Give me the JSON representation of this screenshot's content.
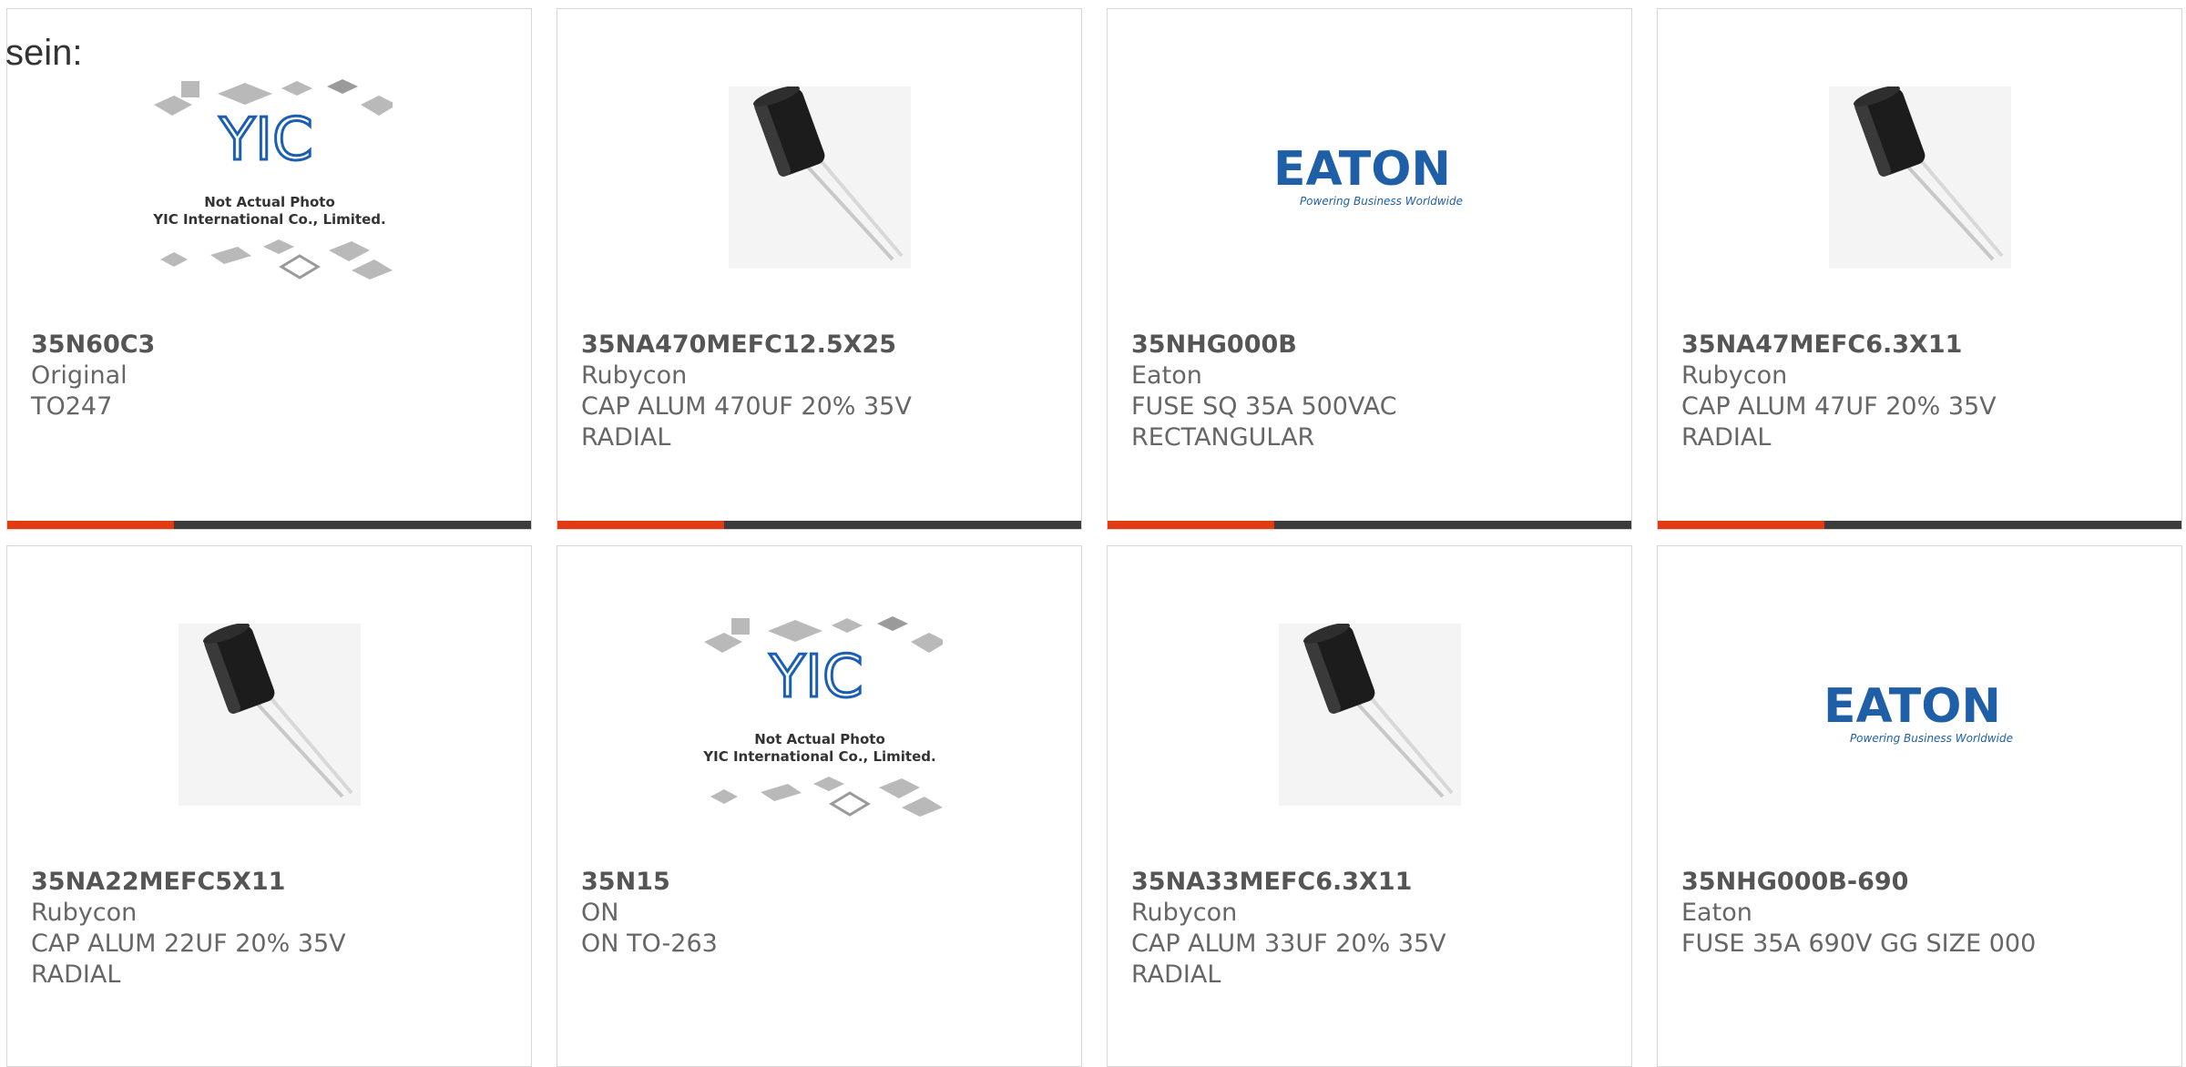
{
  "heading": "sein:",
  "colors": {
    "accent": "#e23a12",
    "bar_dark": "#3c3c3c",
    "eaton_blue": "#1f5fa8",
    "yic_blue": "#1a5fb4"
  },
  "products": [
    {
      "part": "35N60C3",
      "manufacturer": "Original",
      "description": "TO247",
      "image": "yic-placeholder-icon"
    },
    {
      "part": "35NA470MEFC12.5X25",
      "manufacturer": "Rubycon",
      "description": "CAP ALUM 470UF 20% 35V\nRADIAL",
      "image": "capacitor-icon"
    },
    {
      "part": "35NHG000B",
      "manufacturer": "Eaton",
      "description": "FUSE SQ 35A 500VAC\nRECTANGULAR",
      "image": "eaton-logo"
    },
    {
      "part": "35NA47MEFC6.3X11",
      "manufacturer": "Rubycon",
      "description": "CAP ALUM 47UF 20% 35V\nRADIAL",
      "image": "capacitor-icon"
    },
    {
      "part": "35NA22MEFC5X11",
      "manufacturer": "Rubycon",
      "description": "CAP ALUM 22UF 20% 35V\nRADIAL",
      "image": "capacitor-icon"
    },
    {
      "part": "35N15",
      "manufacturer": "ON",
      "description": "ON TO-263",
      "image": "yic-placeholder-icon"
    },
    {
      "part": "35NA33MEFC6.3X11",
      "manufacturer": "Rubycon",
      "description": "CAP ALUM 33UF 20% 35V\nRADIAL",
      "image": "capacitor-icon"
    },
    {
      "part": "35NHG000B-690",
      "manufacturer": "Eaton",
      "description": "FUSE 35A 690V GG SIZE 000",
      "image": "eaton-logo"
    }
  ],
  "placeholder": {
    "line1": "Not Actual Photo",
    "line2": "YIC International Co., Limited.",
    "logo": "YIC"
  },
  "eaton": {
    "wordmark": "EATON",
    "tagline": "Powering Business Worldwide"
  }
}
